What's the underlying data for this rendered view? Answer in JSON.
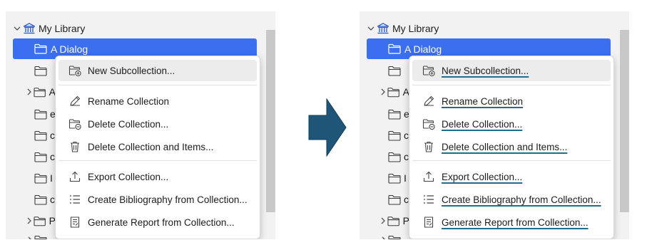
{
  "colors": {
    "selection": "#3b6ff0",
    "arrow": "#1f5577",
    "underline": "#1f6e8c"
  },
  "panels": [
    {
      "root_label": "My Library",
      "selected_label": "A Dialog",
      "menu": [
        {
          "label": "New Subcollection...",
          "icon": "new-collection-icon"
        },
        {
          "label": "Rename Collection",
          "icon": "pencil-icon"
        },
        {
          "label": "Delete Collection...",
          "icon": "delete-collection-icon"
        },
        {
          "label": "Delete Collection and Items...",
          "icon": "trash-icon"
        },
        {
          "label": "Export Collection...",
          "icon": "export-icon"
        },
        {
          "label": "Create Bibliography from Collection...",
          "icon": "bibliography-icon"
        },
        {
          "label": "Generate Report from Collection...",
          "icon": "report-icon"
        }
      ]
    },
    {
      "root_label": "My Library",
      "selected_label": "A Dialog",
      "menu": [
        {
          "label": "New Subcollection...",
          "icon": "new-collection-icon"
        },
        {
          "label": "Rename Collection",
          "icon": "pencil-icon"
        },
        {
          "label": "Delete Collection...",
          "icon": "delete-collection-icon"
        },
        {
          "label": "Delete Collection and Items...",
          "icon": "trash-icon"
        },
        {
          "label": "Export Collection...",
          "icon": "export-icon"
        },
        {
          "label": "Create Bibliography from Collection...",
          "icon": "bibliography-icon"
        },
        {
          "label": "Generate Report from Collection...",
          "icon": "report-icon"
        }
      ]
    }
  ],
  "tree_fragments": [
    "",
    "A",
    "e",
    "c",
    "c",
    "I",
    "c",
    "P",
    ""
  ]
}
